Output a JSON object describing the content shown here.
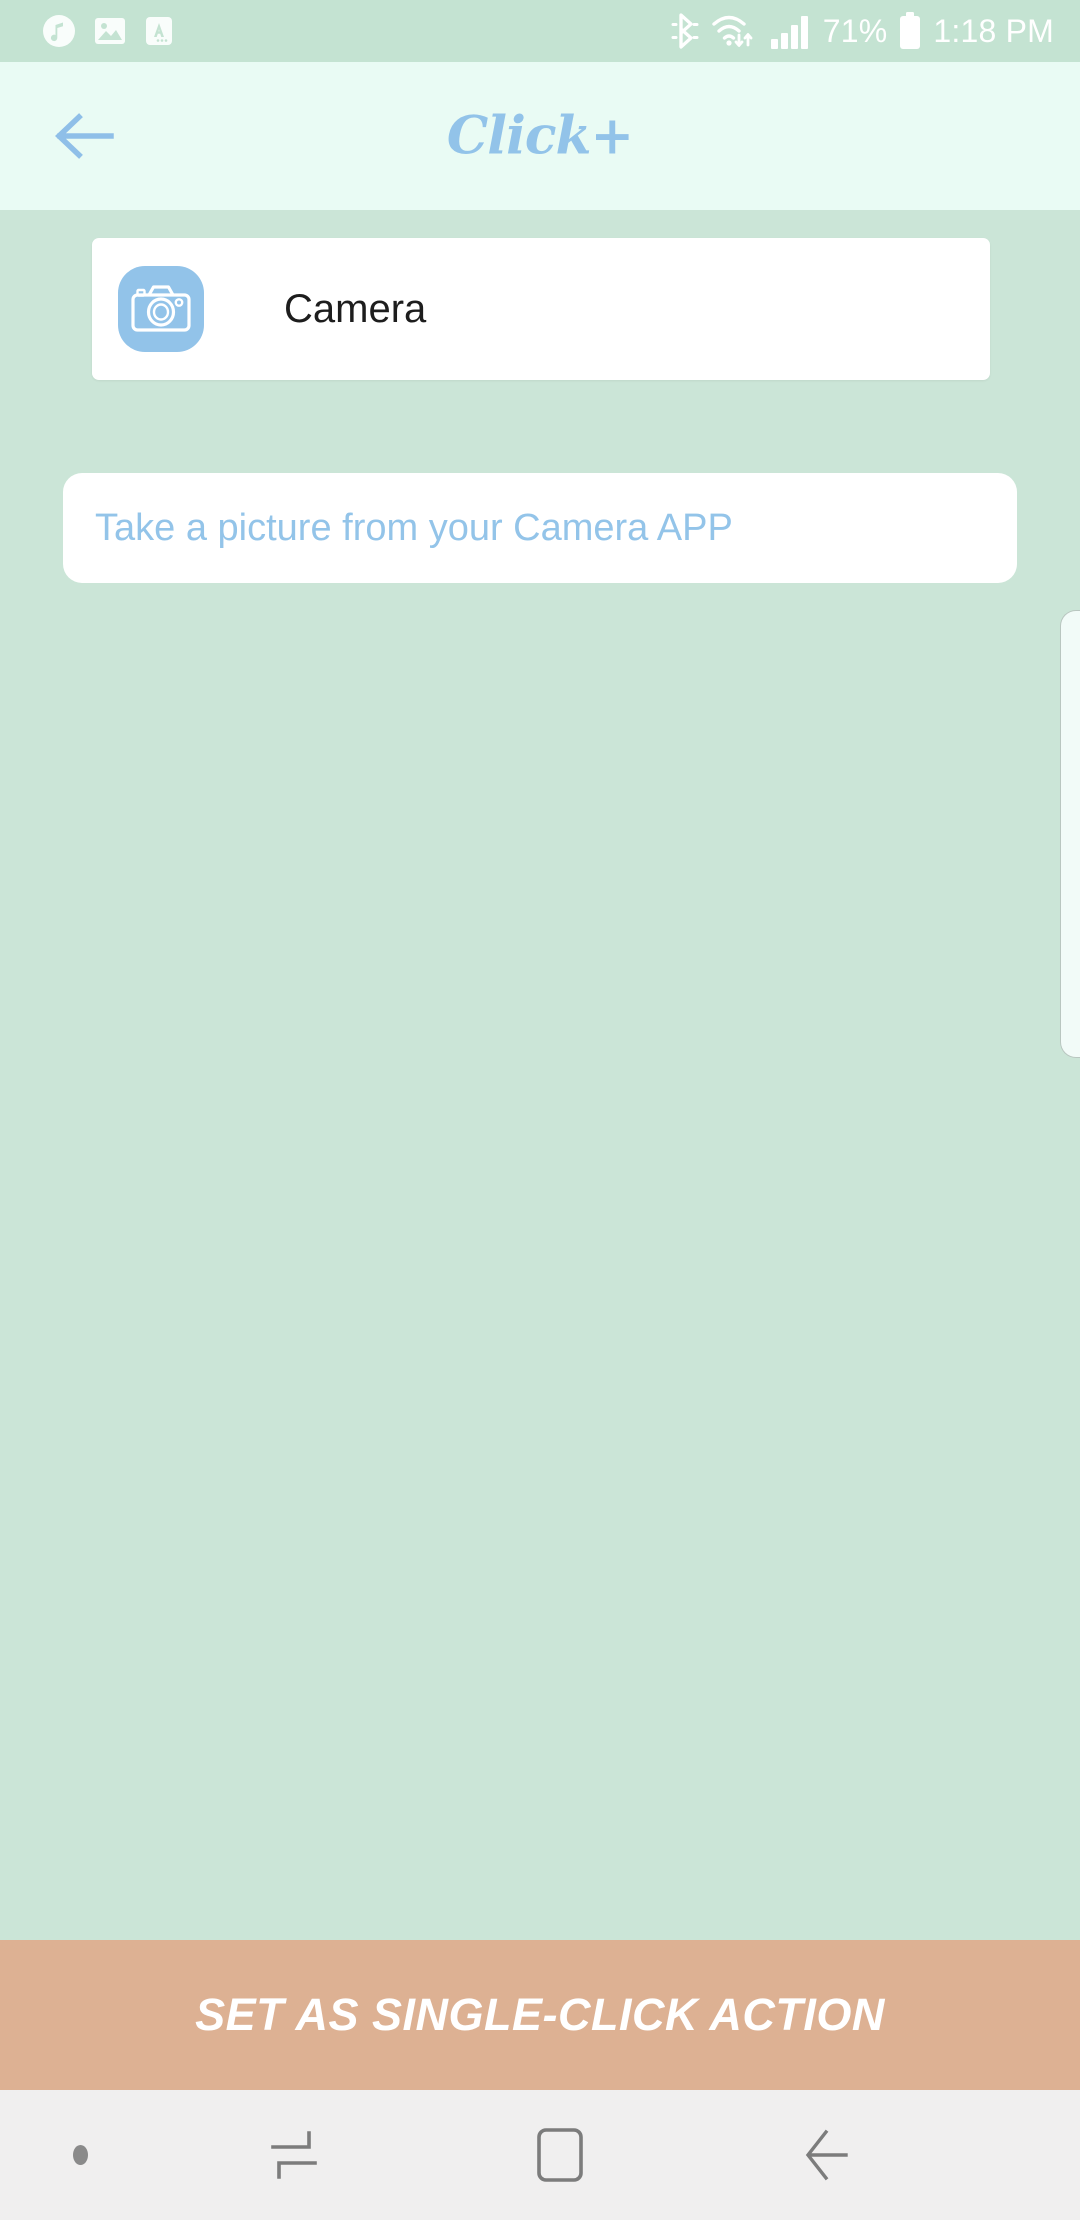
{
  "status_bar": {
    "background": "#c4e3d2",
    "notification_icons": [
      "music-note-icon",
      "image-icon",
      "text-translate-icon"
    ],
    "bluetooth_icon": "bluetooth-icon",
    "wifi_icon": "wifi-icon",
    "signal_icon": "cellular-signal-icon",
    "battery_percent": "71%",
    "battery_icon": "battery-icon",
    "time": "1:18 PM"
  },
  "app_bar": {
    "background": "#e9fbf4",
    "back_icon": "arrow-left-icon",
    "title": "Click+",
    "title_color": "#92c3e9"
  },
  "content": {
    "background": "#cbe5d7",
    "app_card": {
      "icon": "camera-icon",
      "icon_background": "#92c3e9",
      "name": "Camera"
    },
    "description_field": {
      "value": "Take a picture from your Camera APP",
      "placeholder": "Take a picture from your Camera APP",
      "text_color": "#93c4e9"
    },
    "edge_panel_handle": "edge-panel-handle"
  },
  "action_button": {
    "label": "SET AS SINGLE-CLICK ACTION",
    "background": "#ddb193",
    "text_color": "#ffffff"
  },
  "nav_bar": {
    "background": "#f0efef",
    "items": [
      {
        "name": "nav-indicator-dot",
        "icon": "dot-icon"
      },
      {
        "name": "nav-recents",
        "icon": "recents-icon"
      },
      {
        "name": "nav-home",
        "icon": "home-icon"
      },
      {
        "name": "nav-back",
        "icon": "back-icon"
      }
    ]
  }
}
